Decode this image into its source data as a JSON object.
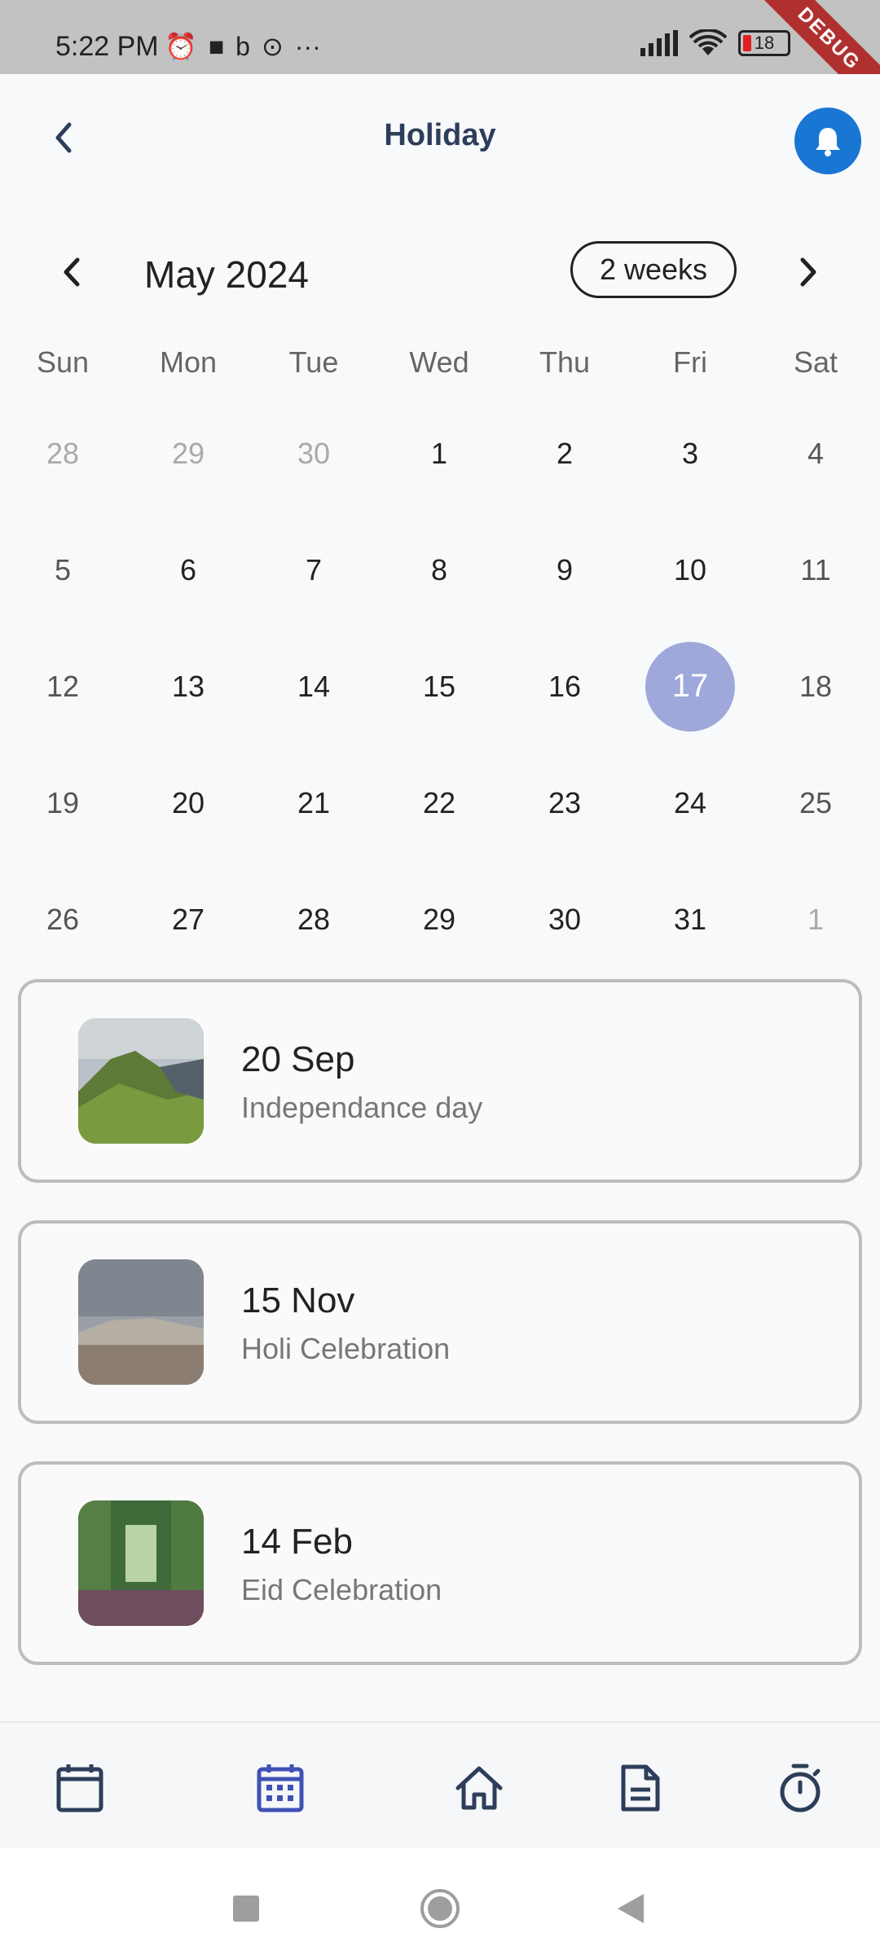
{
  "status_bar": {
    "time": "5:22 PM",
    "battery": "18",
    "debug_banner": "DEBUG"
  },
  "app_bar": {
    "title": "Holiday"
  },
  "calendar": {
    "month_label": "May 2024",
    "format_button": "2 weeks",
    "weekdays": [
      "Sun",
      "Mon",
      "Tue",
      "Wed",
      "Thu",
      "Fri",
      "Sat"
    ],
    "selected_day": "17",
    "weeks": [
      [
        "28",
        "29",
        "30",
        "1",
        "2",
        "3",
        "4"
      ],
      [
        "5",
        "6",
        "7",
        "8",
        "9",
        "10",
        "11"
      ],
      [
        "12",
        "13",
        "14",
        "15",
        "16",
        "17",
        "18"
      ],
      [
        "19",
        "20",
        "21",
        "22",
        "23",
        "24",
        "25"
      ],
      [
        "26",
        "27",
        "28",
        "29",
        "30",
        "31",
        "1"
      ]
    ]
  },
  "holidays": [
    {
      "date": "20 Sep",
      "name": "Independance day"
    },
    {
      "date": "15 Nov",
      "name": "Holi Celebration"
    },
    {
      "date": "14 Feb",
      "name": "Eid Celebration"
    }
  ],
  "colors": {
    "accent": "#1976d2",
    "selected_day_bg": "#9fa8da",
    "nav_icon": "#2d3e5a",
    "nav_icon_active": "#3f51b5"
  },
  "bottom_nav": [
    "calendar-icon",
    "calendar-grid-icon",
    "home-icon",
    "document-icon",
    "timer-icon"
  ]
}
